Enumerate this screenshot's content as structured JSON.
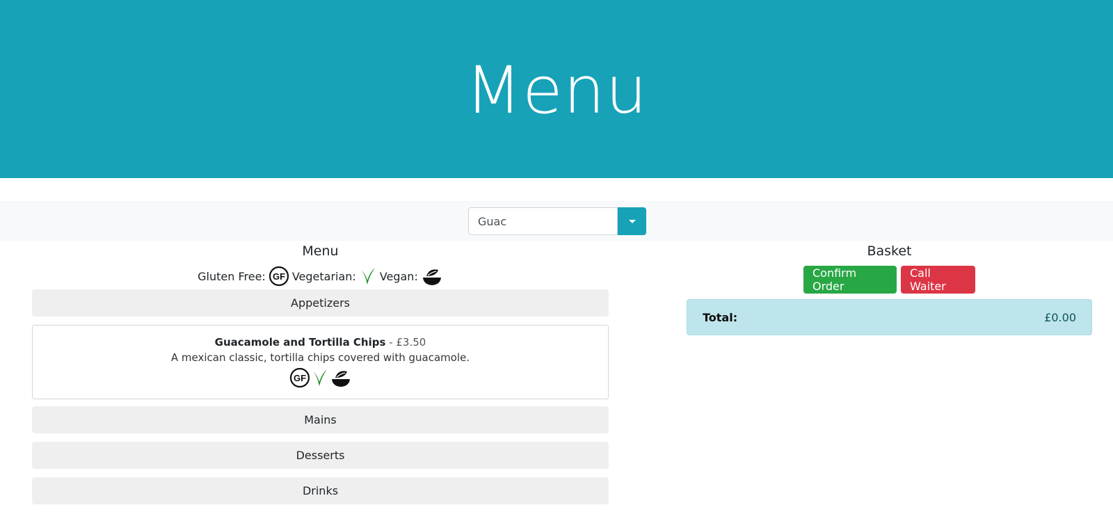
{
  "header": {
    "title": "Menu"
  },
  "filter": {
    "value": "Guac"
  },
  "menu": {
    "title": "Menu",
    "legend": {
      "gluten_free_label": "Gluten Free:",
      "vegetarian_label": "Vegetarian:",
      "vegan_label": "Vegan:"
    },
    "categories": [
      {
        "label": "Appetizers"
      },
      {
        "label": "Mains"
      },
      {
        "label": "Desserts"
      },
      {
        "label": "Drinks"
      }
    ],
    "items": [
      {
        "name": "Guacamole and Tortilla Chips",
        "price": "- £3.50",
        "description": "A mexican classic, tortilla chips covered with guacamole.",
        "icons": [
          "gluten-free-icon",
          "vegetarian-icon",
          "vegan-icon"
        ]
      }
    ]
  },
  "basket": {
    "title": "Basket",
    "confirm_label": "Confirm Order",
    "call_waiter_label": "Call Waiter",
    "total_label": "Total:",
    "total_value": "£0.00"
  },
  "colors": {
    "header_bg": "#17a2b8",
    "confirm_bg": "#28a745",
    "call_waiter_bg": "#dc3545",
    "total_bg": "#bee5eb",
    "vegetarian_icon": "#1a8a1a"
  }
}
